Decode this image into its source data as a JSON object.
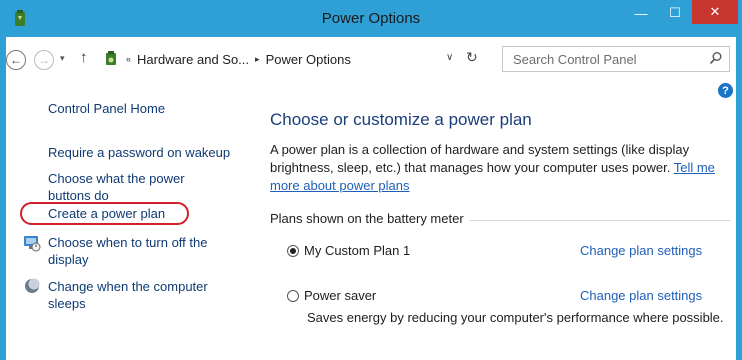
{
  "window": {
    "title": "Power Options",
    "minimize_glyph": "—",
    "maximize_glyph": "☐",
    "close_glyph": "✕",
    "title_bar_color": "#2fa0d6",
    "close_color": "#c7372f"
  },
  "nav": {
    "back_glyph": "←",
    "forward_glyph": "→",
    "recent_glyph": "▾",
    "up_glyph": "↑",
    "breadcrumb_prefix": "«",
    "breadcrumb": [
      "Hardware and So...",
      "Power Options"
    ],
    "breadcrumb_sep": "▸",
    "dropdown_glyph": "∨",
    "refresh_glyph": "↻",
    "search_placeholder": "Search Control Panel"
  },
  "sidebar": {
    "home": "Control Panel Home",
    "links": [
      "Require a password on wakeup",
      "Choose what the power buttons do",
      "Create a power plan",
      "Choose when to turn off the display",
      "Change when the computer sleeps"
    ],
    "icons": [
      "display-power-icon",
      "sleep-moon-icon"
    ],
    "highlight_color": "#d0202a"
  },
  "main": {
    "help_glyph": "?",
    "title": "Choose or customize a power plan",
    "description": "A power plan is a collection of hardware and system settings (like display brightness, sleep, etc.) that manages how your computer uses power.",
    "learn_more": "Tell me more about power plans",
    "plans_group_label": "Plans shown on the battery meter",
    "plans": [
      {
        "name": "My Custom Plan 1",
        "selected": true,
        "action": "Change plan settings",
        "description": ""
      },
      {
        "name": "Power saver",
        "selected": false,
        "action": "Change plan settings",
        "description": "Saves energy by reducing your computer's performance where possible."
      }
    ]
  }
}
